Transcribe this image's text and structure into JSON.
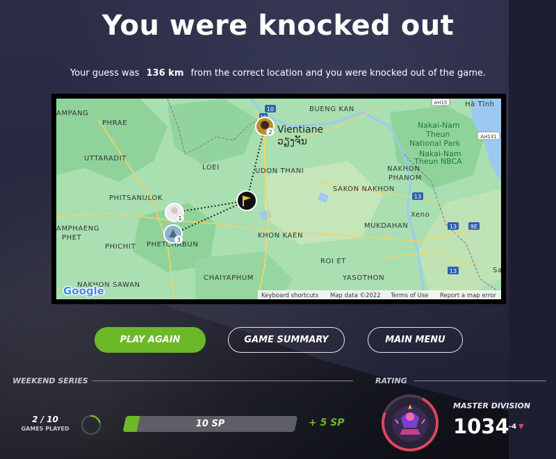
{
  "header": {
    "title": "You were knocked out",
    "subtitle_pre": "Your guess was",
    "distance": "136 km",
    "subtitle_post": "from the correct location and you were knocked out of the game."
  },
  "map": {
    "labels": {
      "ampang": "AMPANG",
      "phrae": "PHRAE",
      "uttaradit": "UTTARADIT",
      "loei": "LOEI",
      "udon_thani": "UDON THANI",
      "bueng_kan": "BUENG KAN",
      "vientiane": "Vientiane",
      "vientiane_lao": "ວຽງຈັນ",
      "nakai_nam_theun": "Nakai-Nam\nTheun\nNational Park",
      "nakai_nbca": "Nakai-Nam\nTheun NBCA",
      "ha_tinh": "Hà Tĩnh",
      "phitsanulok": "PHITSANULOK",
      "sakon_nakhon": "SAKON NAKHON",
      "nakhon_phanom": "NAKHON\nPHANOM",
      "xeno": "Xeno",
      "amphaeng_phet": "AMPHAENG\nPHET",
      "phichit": "PHICHIT",
      "phetchabun": "PHETCHABUN",
      "khon_kaen": "KHON KAEN",
      "mukdahan": "MUKDAHAN",
      "roi_et": "ROI ET",
      "chaiyaphum": "CHAIYAPHUM",
      "yasothon": "YASOTHON",
      "nakhon_sawan": "NAKHON SAWAN",
      "sa": "Sa"
    },
    "road_badges": [
      "10",
      "10",
      "13",
      "13",
      "9E",
      "13",
      "AH15",
      "AH131"
    ],
    "markers": [
      {
        "label": "1"
      },
      {
        "label": "2"
      },
      {
        "label": "3"
      }
    ],
    "footer": {
      "logo": "Google",
      "shortcuts": "Keyboard shortcuts",
      "map_data": "Map data ©2022",
      "terms": "Terms of Use",
      "report": "Report a map error"
    }
  },
  "actions": {
    "play_again": "PLAY AGAIN",
    "game_summary": "GAME SUMMARY",
    "main_menu": "MAIN MENU"
  },
  "weekend_series": {
    "label": "WEEKEND SERIES",
    "games_played_count": "2 / 10",
    "games_played_label": "GAMES PLAYED",
    "games_progress": 0.2,
    "sp_value": "10 SP",
    "sp_progress": 0.08,
    "sp_gain": "+ 5 SP"
  },
  "rating": {
    "label": "RATING",
    "division": "MASTER DIVISION",
    "value": "1034",
    "delta": "-4",
    "ring_progress": 0.72
  },
  "colors": {
    "accent_green": "#6cb928",
    "rating_pink": "#e0455e",
    "map_land": "#a9dfb1"
  }
}
